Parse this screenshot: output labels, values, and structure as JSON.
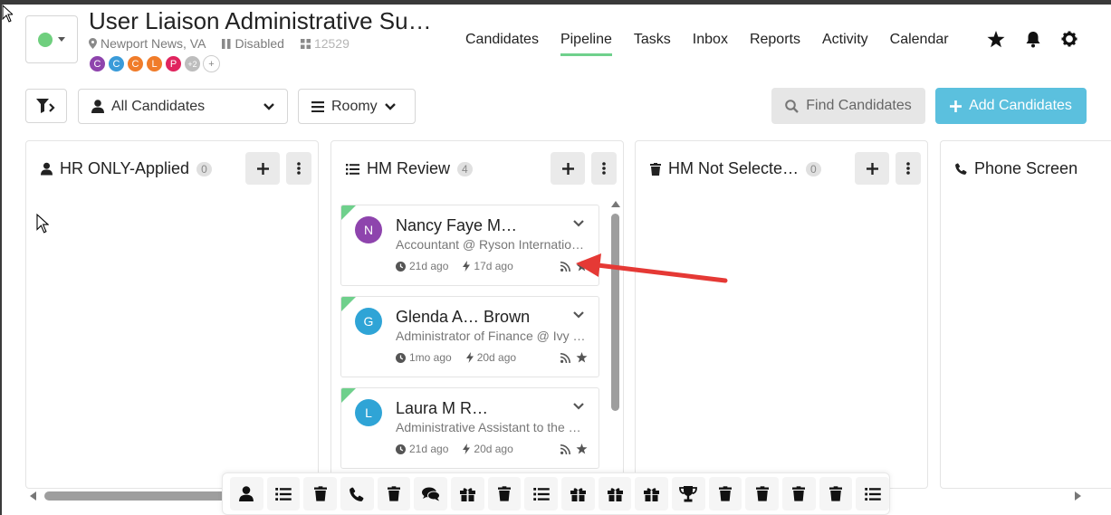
{
  "header": {
    "job_title": "User Liaison Administrative Su…",
    "location": "Newport News, VA",
    "status": "Disabled",
    "job_id": "12529",
    "status_color": "#6fcf7e",
    "team_avatars": [
      {
        "letter": "C",
        "color": "#8e44ad"
      },
      {
        "letter": "C",
        "color": "#3a9bd9"
      },
      {
        "letter": "C",
        "color": "#f07c2a"
      },
      {
        "letter": "L",
        "color": "#f07c2a"
      },
      {
        "letter": "P",
        "color": "#e0245e"
      }
    ],
    "more_count": "+2",
    "add_symbol": "+"
  },
  "nav": {
    "tabs": [
      {
        "label": "Candidates",
        "active": false
      },
      {
        "label": "Pipeline",
        "active": true
      },
      {
        "label": "Tasks",
        "active": false
      },
      {
        "label": "Inbox",
        "active": false
      },
      {
        "label": "Reports",
        "active": false
      },
      {
        "label": "Activity",
        "active": false
      },
      {
        "label": "Calendar",
        "active": false
      }
    ],
    "icons": [
      "star-icon",
      "bell-icon",
      "gear-icon"
    ]
  },
  "toolbar": {
    "candidate_filter": "All Candidates",
    "view_mode": "Roomy",
    "find_label": "Find Candidates",
    "add_label": "Add Candidates",
    "add_color": "#5bc0de"
  },
  "columns": [
    {
      "title": "HR ONLY-Applied",
      "count": "0",
      "icon": "user-icon"
    },
    {
      "title": "HM Review",
      "count": "4",
      "icon": "list-icon"
    },
    {
      "title": "HM Not Selecte…",
      "count": "0",
      "icon": "trash-icon"
    },
    {
      "title": "Phone Screen",
      "icon": "phone-icon"
    }
  ],
  "cards": [
    {
      "initial": "N",
      "avatar_color": "#8e44ad",
      "name": "Nancy Faye M…",
      "title": "Accountant @ Ryson Internatio…",
      "created": "21d ago",
      "activity": "17d ago"
    },
    {
      "initial": "G",
      "avatar_color": "#2fa4d6",
      "name": "Glenda A… Brown",
      "title": "Administrator of Finance @ Ivy …",
      "created": "1mo ago",
      "activity": "20d ago"
    },
    {
      "initial": "L",
      "avatar_color": "#2fa4d6",
      "name": "Laura M R…",
      "title": "Administrative Assistant to the P…",
      "created": "21d ago",
      "activity": "20d ago"
    }
  ],
  "stage_bar": {
    "icons": [
      "user-icon",
      "list-icon",
      "trash-icon",
      "phone-icon",
      "trash-icon",
      "chat-icon",
      "gift-icon",
      "trash-icon",
      "list-icon",
      "gift-icon",
      "gift-icon",
      "gift-icon",
      "trophy-icon",
      "trash-icon",
      "trash-icon",
      "trash-icon",
      "trash-icon",
      "list-icon"
    ]
  },
  "annotation": {
    "arrow_color": "#e53935"
  }
}
